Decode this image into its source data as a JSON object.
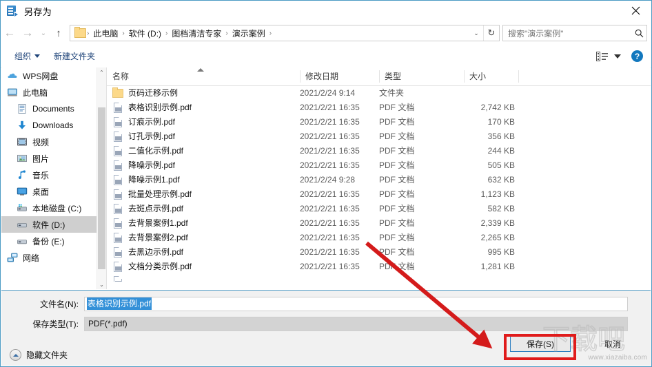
{
  "window": {
    "title": "另存为",
    "close_label": "✕",
    "app_icon": "save-as-icon"
  },
  "nav": {
    "back_label": "←",
    "forward_label": "→",
    "recent_label": "⌄",
    "up_label": "↑",
    "breadcrumb": [
      "此电脑",
      "软件 (D:)",
      "图档清洁专家",
      "演示案例"
    ],
    "separator": "›",
    "dropdown_label": "⌄",
    "refresh_label": "↻"
  },
  "search": {
    "placeholder": "搜索\"演示案例\"",
    "icon": "search-icon"
  },
  "command_bar": {
    "organize_label": "组织",
    "new_folder_label": "新建文件夹",
    "view_icon": "view-layout-icon",
    "view_caret": "▼",
    "help_label": "?"
  },
  "sidebar": {
    "items": [
      {
        "label": "WPS网盘",
        "icon": "cloud-icon",
        "indent": false,
        "selected": false
      },
      {
        "label": "此电脑",
        "icon": "computer-icon",
        "indent": false,
        "selected": false
      },
      {
        "label": "Documents",
        "icon": "documents-icon",
        "indent": true,
        "selected": false
      },
      {
        "label": "Downloads",
        "icon": "downloads-icon",
        "indent": true,
        "selected": false
      },
      {
        "label": "视频",
        "icon": "videos-icon",
        "indent": true,
        "selected": false
      },
      {
        "label": "图片",
        "icon": "pictures-icon",
        "indent": true,
        "selected": false
      },
      {
        "label": "音乐",
        "icon": "music-icon",
        "indent": true,
        "selected": false
      },
      {
        "label": "桌面",
        "icon": "desktop-icon",
        "indent": true,
        "selected": false
      },
      {
        "label": "本地磁盘 (C:)",
        "icon": "system-drive-icon",
        "indent": true,
        "selected": false
      },
      {
        "label": "软件 (D:)",
        "icon": "drive-icon",
        "indent": true,
        "selected": true
      },
      {
        "label": "备份 (E:)",
        "icon": "drive-icon",
        "indent": true,
        "selected": false
      },
      {
        "label": "网络",
        "icon": "network-icon",
        "indent": false,
        "selected": false
      }
    ],
    "scroll_up": "⌃",
    "scroll_down": "⌄"
  },
  "file_list": {
    "columns": [
      "名称",
      "修改日期",
      "类型",
      "大小"
    ],
    "sort_column": "名称",
    "sort_direction": "asc",
    "rows": [
      {
        "name": "页码迁移示例",
        "icon": "folder-icon",
        "date": "2021/2/24 9:14",
        "type": "文件夹",
        "size": ""
      },
      {
        "name": "表格识别示例.pdf",
        "icon": "pdf-icon",
        "date": "2021/2/21 16:35",
        "type": "PDF 文档",
        "size": "2,742 KB"
      },
      {
        "name": "订痕示例.pdf",
        "icon": "pdf-icon",
        "date": "2021/2/21 16:35",
        "type": "PDF 文档",
        "size": "170 KB"
      },
      {
        "name": "订孔示例.pdf",
        "icon": "pdf-icon",
        "date": "2021/2/21 16:35",
        "type": "PDF 文档",
        "size": "356 KB"
      },
      {
        "name": "二值化示例.pdf",
        "icon": "pdf-icon",
        "date": "2021/2/21 16:35",
        "type": "PDF 文档",
        "size": "244 KB"
      },
      {
        "name": "降噪示例.pdf",
        "icon": "pdf-icon",
        "date": "2021/2/21 16:35",
        "type": "PDF 文档",
        "size": "505 KB"
      },
      {
        "name": "降噪示例1.pdf",
        "icon": "pdf-icon",
        "date": "2021/2/24 9:28",
        "type": "PDF 文档",
        "size": "632 KB"
      },
      {
        "name": "批量处理示例.pdf",
        "icon": "pdf-icon",
        "date": "2021/2/21 16:35",
        "type": "PDF 文档",
        "size": "1,123 KB"
      },
      {
        "name": "去斑点示例.pdf",
        "icon": "pdf-icon",
        "date": "2021/2/21 16:35",
        "type": "PDF 文档",
        "size": "582 KB"
      },
      {
        "name": "去背景案例1.pdf",
        "icon": "pdf-icon",
        "date": "2021/2/21 16:35",
        "type": "PDF 文档",
        "size": "2,339 KB"
      },
      {
        "name": "去背景案例2.pdf",
        "icon": "pdf-icon",
        "date": "2021/2/21 16:35",
        "type": "PDF 文档",
        "size": "2,265 KB"
      },
      {
        "name": "去黑边示例.pdf",
        "icon": "pdf-icon",
        "date": "2021/2/21 16:35",
        "type": "PDF 文档",
        "size": "995 KB"
      },
      {
        "name": "文档分类示例.pdf",
        "icon": "pdf-icon",
        "date": "2021/2/21 16:35",
        "type": "PDF 文档",
        "size": "1,281 KB"
      }
    ]
  },
  "form": {
    "filename_label": "文件名(N):",
    "filename_value": "表格识别示例.pdf",
    "filetype_label": "保存类型(T):",
    "filetype_value": "PDF(*.pdf)",
    "hide_folders_label": "隐藏文件夹",
    "save_label": "保存(S)",
    "cancel_label": "取消"
  },
  "annotations": {
    "highlight_color": "#e01b1b",
    "arrow_target": "save-button"
  },
  "watermark": {
    "logo_text": "下载吧",
    "url_text": "www.xiazaiba.com"
  }
}
